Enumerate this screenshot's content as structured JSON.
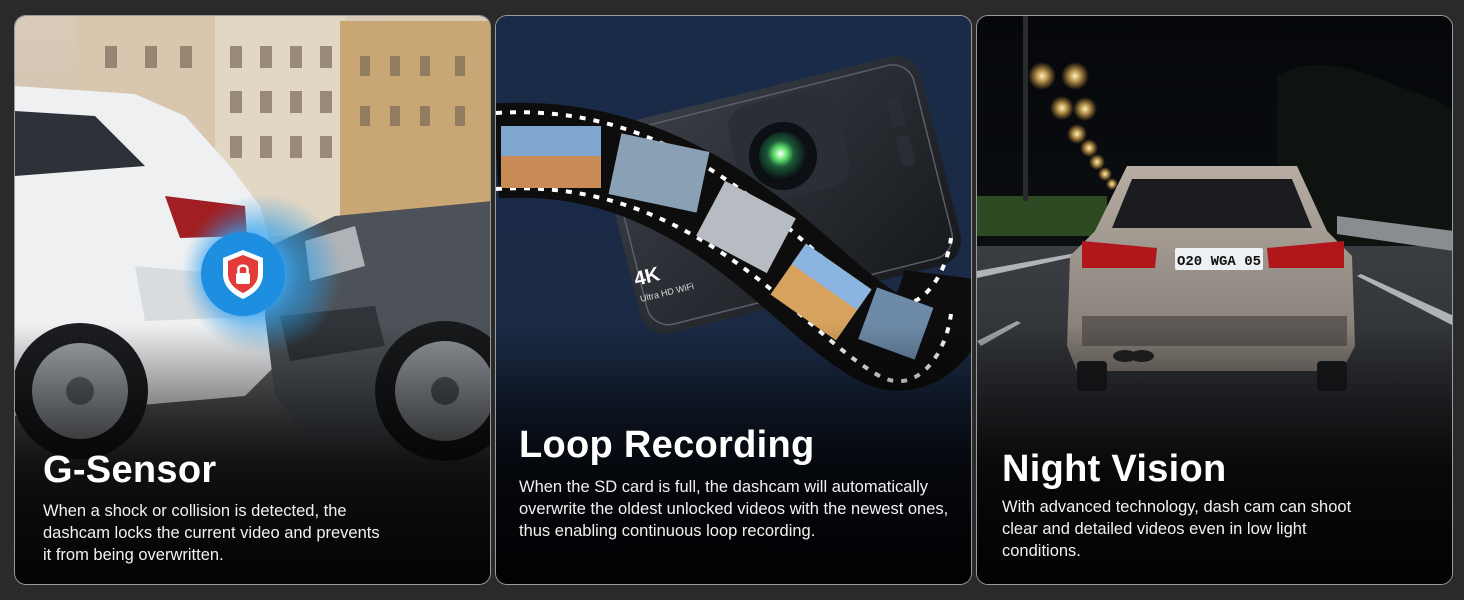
{
  "panels": [
    {
      "title": "G-Sensor",
      "description": "When a shock or collision is detected, the dashcam locks the current video and prevents it from being overwritten.",
      "badge_icon": "shield-lock-icon"
    },
    {
      "title": "Loop Recording",
      "description": "When the SD card is full, the dashcam will automatically overwrite the oldest unlocked videos with the newest ones, thus enabling continuous loop recording.",
      "device_label": "4K",
      "device_sublabel": "Ultra HD WiFi"
    },
    {
      "title": "Night Vision",
      "description": "With advanced technology, dash cam can shoot clear and detailed videos even in low light conditions.",
      "plate_text": "O20 WGA 05"
    }
  ],
  "colors": {
    "background": "#2a2a2a",
    "shield_badge": "#1e8fe0",
    "panel_border": "#9a9a9a"
  }
}
